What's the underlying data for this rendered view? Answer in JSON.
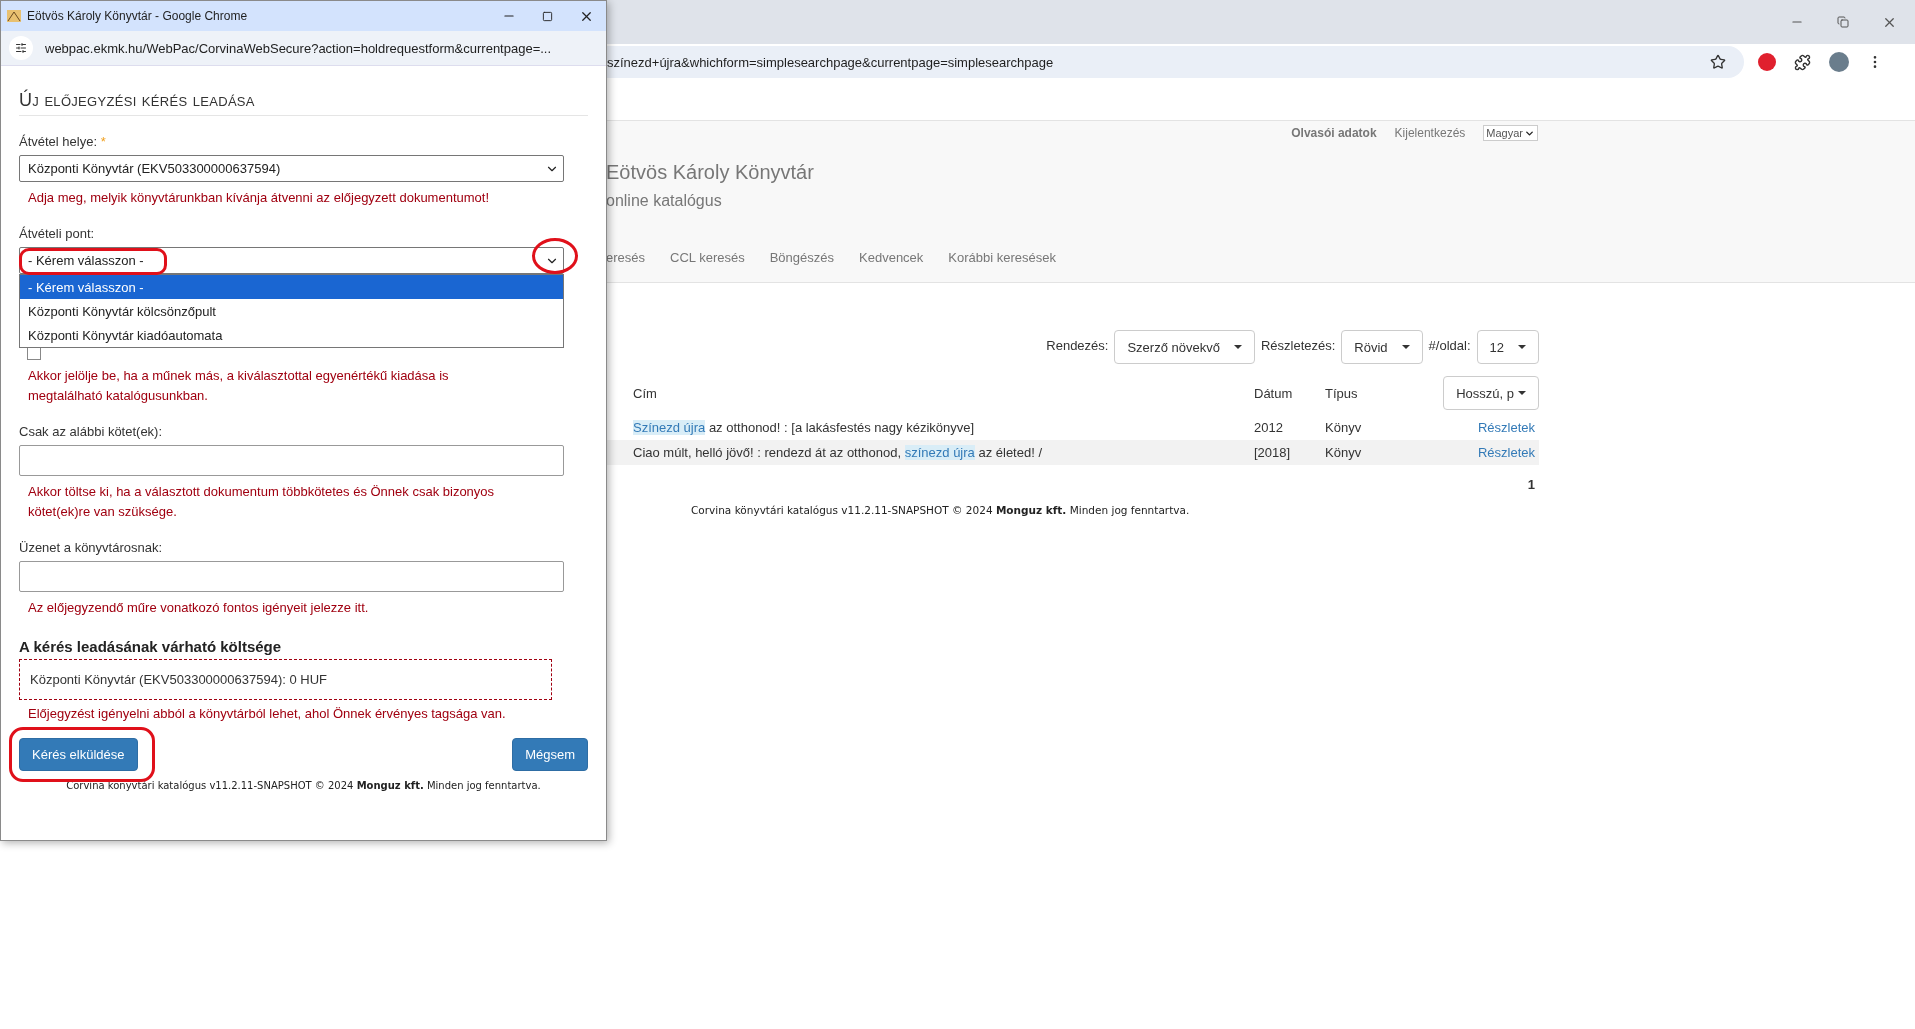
{
  "background_window": {
    "url": "színezd+újra&whichform=simplesearchpage&currentpage=simplesearchpage",
    "header": {
      "user_links": [
        "Olvasói adatok",
        "Kijelentkezés"
      ],
      "language": "Magyar",
      "library_name": "Eötvös Károly Könyvtár",
      "catalog_name": "online katalógus",
      "nav": [
        "eresés",
        "CCL keresés",
        "Böngészés",
        "Kedvencek",
        "Korábbi keresések"
      ]
    },
    "sort_controls": [
      {
        "label": "Rendezés:",
        "value": "Szerző növekvő"
      },
      {
        "label": "Részletezés:",
        "value": "Rövid"
      },
      {
        "label": "#/oldal:",
        "value": "12"
      }
    ],
    "results": {
      "columns": [
        "Cím",
        "Dátum",
        "Típus"
      ],
      "view_button": "Hosszú, p",
      "rows": [
        {
          "title_parts": [
            {
              "text": "Színezd újra",
              "highlighted": true
            },
            {
              "text": " az otthonod! : [a lakásfestés nagy kézikönyve]",
              "highlighted": false
            }
          ],
          "date": "2012",
          "type": "Könyv",
          "link": "Részletek"
        },
        {
          "title_parts": [
            {
              "text": "Ciao múlt, helló jövő! : rendezd át az otthonod, ",
              "highlighted": false
            },
            {
              "text": "színezd újra",
              "highlighted": true
            },
            {
              "text": " az életed! /",
              "highlighted": false
            }
          ],
          "date": "[2018]",
          "type": "Könyv",
          "link": "Részletek"
        }
      ]
    },
    "page": "1",
    "footer": "Corvina könyvtári katalógus v11.2.11-SNAPSHOT © 2024 **Monguz kft.** Minden jog fenntartva."
  },
  "popup": {
    "title": "Eötvös Károly Könyvtár - Google Chrome",
    "url": "webpac.ekmk.hu/WebPac/CorvinaWebSecure?action=holdrequestform&currentpage=...",
    "heading": "Új előjegyzési kérés leadása",
    "fields": [
      {
        "kind": "select",
        "label": "Átvétel helye:",
        "required_mark": "*",
        "value": "Központi Könyvtár (EKV503300000637594)",
        "help": "Adja meg, melyik könyvtárunkban kívánja átvenni az előjegyzett dokumentumot!"
      },
      {
        "kind": "select",
        "label": "Átvételi pont:",
        "value": "- Kérem válasszon -",
        "annotated": true,
        "options": [
          {
            "label": "- Kérem válasszon -",
            "selected": true
          },
          {
            "label": "Központi Könyvtár kölcsönzőpult",
            "selected": false
          },
          {
            "label": "Központi Könyvtár kiadóautomata",
            "selected": false
          }
        ]
      },
      {
        "kind": "checkbox",
        "checked": false,
        "help": "Akkor jelölje be, ha a műnek más, a kiválasztottal egyenértékű kiadása is megtalálható katalógusunkban."
      },
      {
        "kind": "text",
        "label": "Csak az alábbi kötet(ek):",
        "help": "Akkor töltse ki, ha a választott dokumentum többkötetes és Önnek csak bizonyos kötet(ek)re van szüksége."
      },
      {
        "kind": "text",
        "label": "Üzenet a könyvtárosnak:",
        "help": "Az előjegyzendő műre vonatkozó fontos igényeit jelezze itt."
      }
    ],
    "cost": {
      "heading": "A kérés leadásának várható költsége",
      "entry": "Központi Könyvtár (EKV503300000637594): 0 HUF",
      "help": "Előjegyzést igényelni abból a könyvtárból lehet, ahol Önnek érvényes tagsága van."
    },
    "buttons": [
      {
        "label": "Kérés elküldése",
        "annotated": true
      },
      {
        "label": "Mégsem",
        "annotated": false
      }
    ],
    "footer": "Corvina könyvtári katalógus v11.2.11-SNAPSHOT © 2024 **Monguz kft.** Minden jog fenntartva."
  }
}
